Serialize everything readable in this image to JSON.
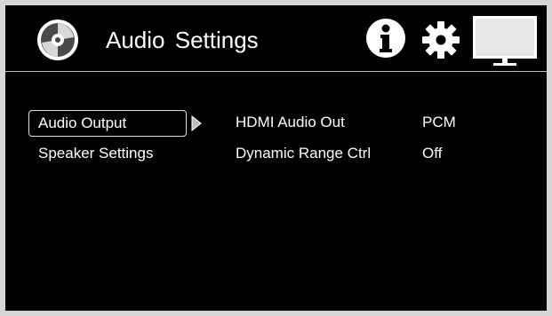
{
  "header": {
    "title": "Audio Settings",
    "icons": [
      "disc-icon",
      "info-icon",
      "gear-icon",
      "tv-icon"
    ]
  },
  "menu": {
    "items": [
      {
        "label": "Audio Output"
      },
      {
        "label": "Speaker Settings"
      }
    ]
  },
  "settings": [
    {
      "name": "HDMI Audio Out",
      "value": "PCM"
    },
    {
      "name": "Dynamic Range Ctrl",
      "value": "Off"
    }
  ],
  "colors": {
    "background": "#000000",
    "text": "#ffffff",
    "border": "#d6d6d6",
    "tv_screen": "#e6e6e6"
  }
}
